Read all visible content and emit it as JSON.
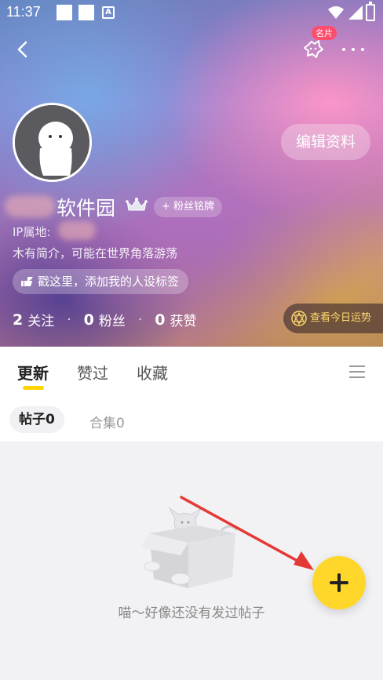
{
  "status_bar": {
    "time": "11:37",
    "a_icon": "A"
  },
  "header": {
    "card_badge": "名片",
    "edit_profile": "编辑资料"
  },
  "profile": {
    "username": "软件园",
    "fan_badge": "+ 粉丝铭牌",
    "ip_label": "IP属地:",
    "bio": "木有简介，可能在世界角落游荡",
    "tag_prompt": "戳这里，添加我的人设标签"
  },
  "stats": {
    "following_count": "2",
    "following_label": "关注",
    "fans_count": "0",
    "fans_label": "粉丝",
    "likes_count": "0",
    "likes_label": "获赞",
    "dot": "·"
  },
  "fortune": {
    "label": "查看今日运势"
  },
  "tabs": [
    {
      "label": "更新",
      "active": true
    },
    {
      "label": "赞过",
      "active": false
    },
    {
      "label": "收藏",
      "active": false
    }
  ],
  "subtabs": [
    {
      "label": "帖子0",
      "active": true
    },
    {
      "label": "合集0",
      "active": false
    }
  ],
  "empty": {
    "message": "喵～好像还没有发过帖子"
  },
  "colors": {
    "accent": "#ffd62a",
    "arrow": "#e53935",
    "badge": "#ff4d6d"
  }
}
